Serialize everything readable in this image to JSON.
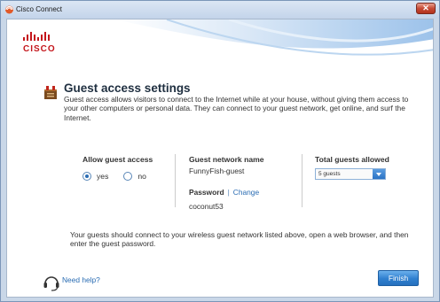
{
  "window": {
    "title": "Cisco Connect",
    "close_label": "✕"
  },
  "brand": {
    "logo_text": "CISCO",
    "accent_color": "#c4161c",
    "link_color": "#2a6cb3"
  },
  "page": {
    "title": "Guest access settings",
    "intro": "Guest access allows visitors to connect to the Internet while at your house, without giving them access to your other computers or personal data. They can connect to your guest network, get online, and surf the Internet."
  },
  "allow_guest": {
    "heading": "Allow guest access",
    "options": [
      {
        "label": "yes",
        "selected": true
      },
      {
        "label": "no",
        "selected": false
      }
    ]
  },
  "network": {
    "heading": "Guest network name",
    "name": "FunnyFish-guest",
    "password_label": "Password",
    "separator": "|",
    "change_label": "Change",
    "password": "coconut53"
  },
  "guests": {
    "heading": "Total guests allowed",
    "selected": "5 guests"
  },
  "note": "Your guests should connect to your wireless guest network listed above, open a web browser, and then enter the guest password.",
  "footer": {
    "help_label": "Need help?",
    "finish_label": "Finish"
  }
}
